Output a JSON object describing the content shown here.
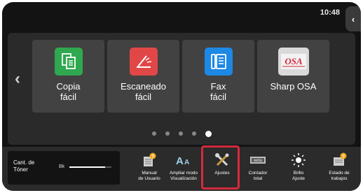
{
  "status": {
    "time": "10:48"
  },
  "tiles": [
    {
      "label_line1": "Copia",
      "label_line2": "fácil",
      "icon": "copy-icon",
      "color": "#2fa84f"
    },
    {
      "label_line1": "Escaneado",
      "label_line2": "fácil",
      "icon": "scanner-icon",
      "color": "#e24747"
    },
    {
      "label_line1": "Fax",
      "label_line2": "fácil",
      "icon": "fax-icon",
      "color": "#1e88e5"
    },
    {
      "label_line1": "Sharp OSA",
      "label_line2": "",
      "icon": "sharp-osa-icon",
      "color": "#d9d9d9",
      "logo_text": "OSA"
    }
  ],
  "pager": {
    "pages": 5,
    "active_index": 4
  },
  "toner": {
    "label_line1": "Cant. de",
    "label_line2": "Tóner",
    "color_label": "Bk",
    "level": 0.85
  },
  "bottom_items": [
    {
      "line1": "Manual",
      "line2": "de Usuario",
      "icon": "manual-icon"
    },
    {
      "line1": "Ampliar modo",
      "line2": "Visualización",
      "icon": "text-size-icon"
    },
    {
      "line1": "Ajustes",
      "line2": "",
      "icon": "settings-tools-icon",
      "highlighted": true
    },
    {
      "line1": "Contador",
      "line2": "total",
      "icon": "counter-icon"
    },
    {
      "line1": "Brillo",
      "line2": "Ajuste",
      "icon": "brightness-icon"
    },
    {
      "line1": "Estado de",
      "line2": "trabajos",
      "icon": "job-status-icon"
    }
  ],
  "colors": {
    "highlight": "#d42a3e",
    "background": "#131313",
    "tile": "#424242"
  }
}
